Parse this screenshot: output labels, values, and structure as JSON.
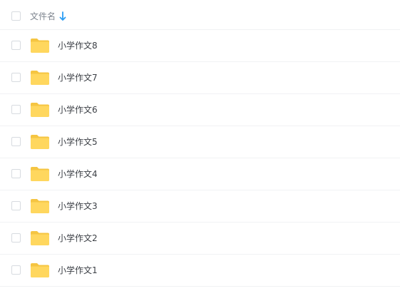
{
  "header": {
    "select_all_checked": false,
    "column_label": "文件名",
    "sort_icon": "arrow-down-icon",
    "sort_color": "#2a9df4"
  },
  "files": [
    {
      "name": "小学作文8",
      "type": "folder",
      "checked": false
    },
    {
      "name": "小学作文7",
      "type": "folder",
      "checked": false
    },
    {
      "name": "小学作文6",
      "type": "folder",
      "checked": false
    },
    {
      "name": "小学作文5",
      "type": "folder",
      "checked": false
    },
    {
      "name": "小学作文4",
      "type": "folder",
      "checked": false
    },
    {
      "name": "小学作文3",
      "type": "folder",
      "checked": false
    },
    {
      "name": "小学作文2",
      "type": "folder",
      "checked": false
    },
    {
      "name": "小学作文1",
      "type": "folder",
      "checked": false
    }
  ],
  "colors": {
    "folder_back": "#f5c542",
    "folder_front": "#ffd75e"
  }
}
